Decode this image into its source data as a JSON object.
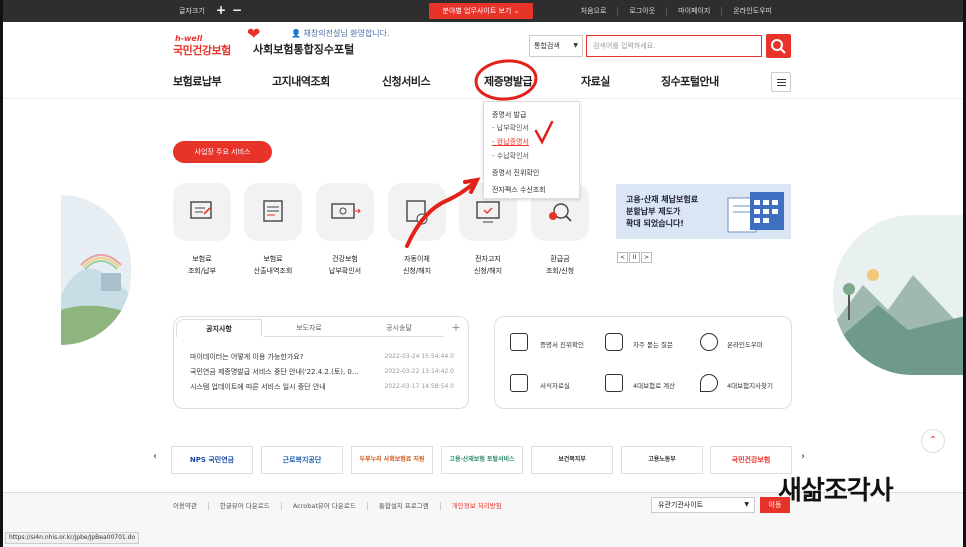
{
  "topbar": {
    "font_size_label": "글자크기",
    "font_plus": "+",
    "font_minus": "−",
    "business_site_button": "분야별 업무사이트 보기 ⌄",
    "links": [
      "처음으로",
      "로그아웃",
      "마이페이지",
      "온라인도우미"
    ]
  },
  "header": {
    "logo_hwell": "h-well",
    "logo_name": "국민건강보험",
    "portal_title": "사회보험통합징수포털",
    "welcome": "채창의전설님 환영합니다.",
    "search_scope": "통합검색",
    "search_placeholder": "검색어를 입력하세요."
  },
  "nav": {
    "items": [
      "보험료납부",
      "고지내역조회",
      "신청서비스",
      "제증명발급",
      "자료실",
      "징수포털안내"
    ]
  },
  "dropdown": {
    "group1": "증명서 발급",
    "sub1": "- 납부확인서",
    "sub2": "- 완납증명서",
    "sub3": "- 수납확인서",
    "group2": "증명서 진위확인",
    "group3": "전자팩스 수신조회"
  },
  "services": {
    "title_button": "사업장 주요 서비스",
    "items": [
      {
        "line1": "보험료",
        "line2": "조회/납부"
      },
      {
        "line1": "보험료",
        "line2": "산출내역조회"
      },
      {
        "line1": "건강보험",
        "line2": "납부확인서"
      },
      {
        "line1": "자동이체",
        "line2": "신청/해지"
      },
      {
        "line1": "전자고지",
        "line2": "신청/해지"
      },
      {
        "line1": "환급금",
        "line2": "조회/신청"
      }
    ],
    "banner_line1": "고용·산재 체납보험료",
    "banner_line2": "분할납부 제도가",
    "banner_line3": "확대 되었습니다!",
    "controls": [
      "<",
      "II",
      ">"
    ]
  },
  "notices": {
    "tabs": [
      "공지사항",
      "보도자료",
      "공시송달"
    ],
    "plus": "+",
    "rows": [
      {
        "title": "마이데이터는 어떻게 이용 가능한가요?",
        "date": "2022-03-24 15:54:44.0"
      },
      {
        "title": "국민연금 제증명발급 서비스 중단 안내('22.4.2.(토), 0...",
        "date": "2022-03-22 13:14:42.0"
      },
      {
        "title": "시스템 업데이트에 따른 서비스 일시 중단 안내",
        "date": "2022-03-17 14:58:54.0"
      }
    ]
  },
  "quick": {
    "items": [
      "증명서 진위확인",
      "자주 묻는 질문",
      "온라인도우미",
      "서식자료실",
      "4대보험료 계산",
      "4대보험지사찾기"
    ]
  },
  "partners": {
    "prev": "‹",
    "next": "›",
    "items": [
      "NPS 국민연금",
      "근로복지공단",
      "두루누리 사회보험료 지원",
      "고용·산재보험 토탈서비스",
      "보건복지부",
      "고용노동부",
      "국민건강보험"
    ]
  },
  "totop": "⌃",
  "footer": {
    "links": [
      "이용약관",
      "한글뷰어 다운로드",
      "Acrobat뷰어 다운로드",
      "통합설치 프로그램",
      "개인정보 처리방침"
    ],
    "related_sites": "유관기관사이트",
    "go_button": "이동"
  },
  "status_url": "https://si4n.nhis.or.kr/jpbe/JpBea00701.do",
  "watermark": "새삶조각사",
  "colors": {
    "brand_red": "#e8332a",
    "topbar": "#2e2e2e",
    "banner_bg": "#dbe6f4"
  }
}
